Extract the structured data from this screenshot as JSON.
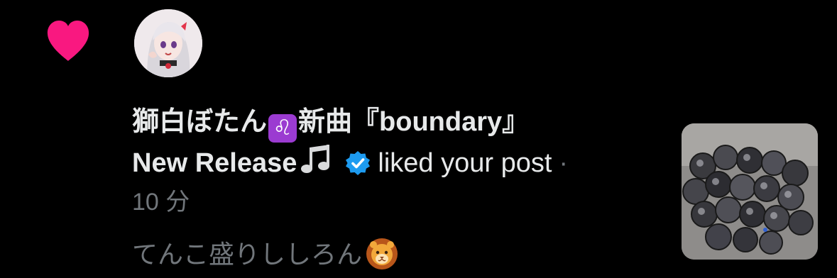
{
  "notification": {
    "type": "like",
    "user": {
      "name_part1": "獅白ぼたん",
      "sign_emoji": "♌",
      "name_part2": "新曲『boundary』",
      "name_part3": "New Release",
      "music_icon": "music-note-icon",
      "verified": true
    },
    "action": "liked your post",
    "separator": "·",
    "time": "10 分",
    "post_text": "てんこ盛りししろん",
    "post_emoji": "lion-face-emoji"
  },
  "colors": {
    "background": "#000000",
    "heart": "#f91880",
    "primary_text": "#e7e9ea",
    "secondary_text": "#71767b",
    "verified_badge": "#1d9bf0",
    "sign_bg": "#9b3bd1"
  }
}
